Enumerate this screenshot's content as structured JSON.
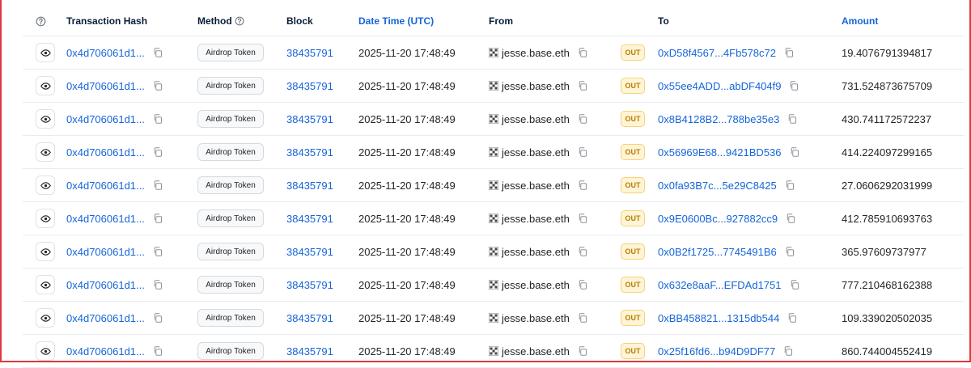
{
  "headers": {
    "transaction_hash": "Transaction Hash",
    "method": "Method",
    "block": "Block",
    "date_time": "Date Time (UTC)",
    "from": "From",
    "to": "To",
    "amount": "Amount"
  },
  "colors": {
    "link": "#1565d8",
    "out_badge_bg": "#fff4d6",
    "out_badge_text": "#b47d00",
    "frame_border": "#e0373d"
  },
  "icons": {
    "row_view": "eye-icon",
    "copy": "copy-icon",
    "help": "question-circle-icon",
    "from_avatar": "blockie-avatar-icon"
  },
  "rows": [
    {
      "hash": "0x4d706061d1...",
      "method": "Airdrop Token",
      "block": "38435791",
      "date": "2025-11-20 17:48:49",
      "from": "jesse.base.eth",
      "direction": "OUT",
      "to": "0xD58f4567...4Fb578c72",
      "amount": "19.4076791394817"
    },
    {
      "hash": "0x4d706061d1...",
      "method": "Airdrop Token",
      "block": "38435791",
      "date": "2025-11-20 17:48:49",
      "from": "jesse.base.eth",
      "direction": "OUT",
      "to": "0x55ee4ADD...abDF404f9",
      "amount": "731.524873675709"
    },
    {
      "hash": "0x4d706061d1...",
      "method": "Airdrop Token",
      "block": "38435791",
      "date": "2025-11-20 17:48:49",
      "from": "jesse.base.eth",
      "direction": "OUT",
      "to": "0x8B4128B2...788be35e3",
      "amount": "430.741172572237"
    },
    {
      "hash": "0x4d706061d1...",
      "method": "Airdrop Token",
      "block": "38435791",
      "date": "2025-11-20 17:48:49",
      "from": "jesse.base.eth",
      "direction": "OUT",
      "to": "0x56969E68...9421BD536",
      "amount": "414.224097299165"
    },
    {
      "hash": "0x4d706061d1...",
      "method": "Airdrop Token",
      "block": "38435791",
      "date": "2025-11-20 17:48:49",
      "from": "jesse.base.eth",
      "direction": "OUT",
      "to": "0x0fa93B7c...5e29C8425",
      "amount": "27.0606292031999"
    },
    {
      "hash": "0x4d706061d1...",
      "method": "Airdrop Token",
      "block": "38435791",
      "date": "2025-11-20 17:48:49",
      "from": "jesse.base.eth",
      "direction": "OUT",
      "to": "0x9E0600Bc...927882cc9",
      "amount": "412.785910693763"
    },
    {
      "hash": "0x4d706061d1...",
      "method": "Airdrop Token",
      "block": "38435791",
      "date": "2025-11-20 17:48:49",
      "from": "jesse.base.eth",
      "direction": "OUT",
      "to": "0x0B2f1725...7745491B6",
      "amount": "365.97609737977"
    },
    {
      "hash": "0x4d706061d1...",
      "method": "Airdrop Token",
      "block": "38435791",
      "date": "2025-11-20 17:48:49",
      "from": "jesse.base.eth",
      "direction": "OUT",
      "to": "0x632e8aaF...EFDAd1751",
      "amount": "777.210468162388"
    },
    {
      "hash": "0x4d706061d1...",
      "method": "Airdrop Token",
      "block": "38435791",
      "date": "2025-11-20 17:48:49",
      "from": "jesse.base.eth",
      "direction": "OUT",
      "to": "0xBB458821...1315db544",
      "amount": "109.339020502035"
    },
    {
      "hash": "0x4d706061d1...",
      "method": "Airdrop Token",
      "block": "38435791",
      "date": "2025-11-20 17:48:49",
      "from": "jesse.base.eth",
      "direction": "OUT",
      "to": "0x25f16fd6...b94D9DF77",
      "amount": "860.744004552419"
    }
  ]
}
